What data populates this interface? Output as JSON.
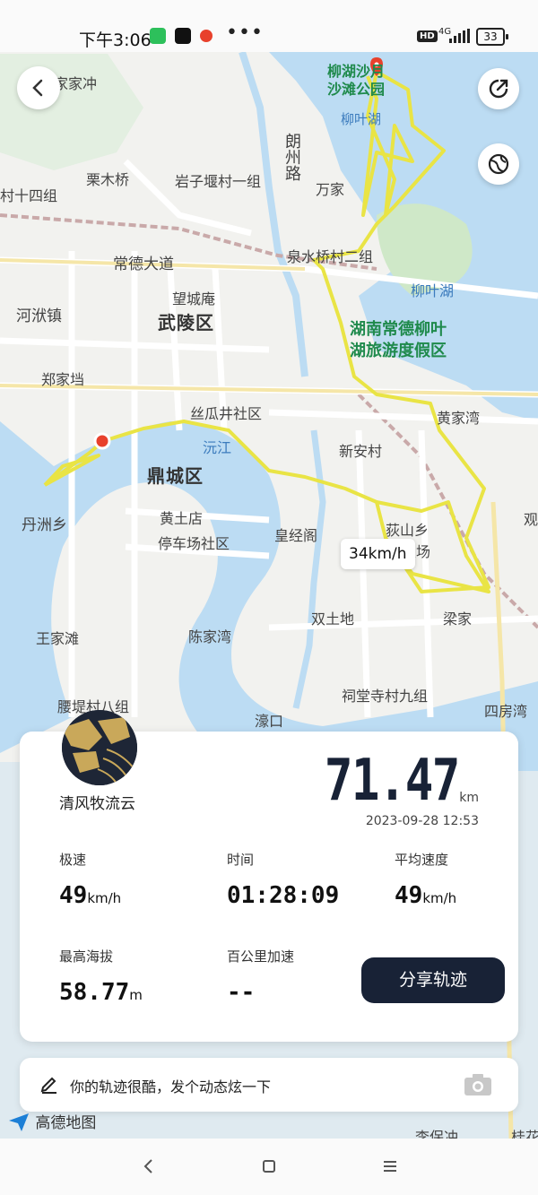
{
  "status_bar": {
    "time": "下午3:06",
    "hd": "HD",
    "network": "4G",
    "battery": "33"
  },
  "map": {
    "labels": {
      "liuhu_park": "柳湖沙月\n沙滩公园",
      "liuye_lake_top": "柳叶湖",
      "langzhou_road": "朗州路",
      "wanjia": "万家",
      "jiajiachong": "家家冲",
      "limuqiao": "栗木桥",
      "yanziyan": "岩子堰村一组",
      "village14": "村十四组",
      "quanshuiqiao": "泉水桥村二组",
      "liuye_lake": "柳叶湖",
      "changde_road": "常德大道",
      "wangchengan": "望城庵",
      "wuling": "武陵区",
      "hezhuang": "河洑镇",
      "resort": "湖南常德柳叶\n湖旅游度假区",
      "zhengjiadang": "郑家垱",
      "siguajing": "丝瓜井社区",
      "huangjiawan": "黄家湾",
      "yuanjiang": "沅江",
      "dingcheng": "鼎城区",
      "xinan": "新安村",
      "danzhou": "丹洲乡",
      "huangtudian": "黄土店",
      "tingchechang": "停车场社区",
      "huangjingge": "皇经阁",
      "disha": "荻山乡",
      "yejiawu": "叶家屋场",
      "shuangtudi": "双土地",
      "liangjia": "梁家",
      "wangjiatan": "王家滩",
      "chenjiawan": "陈家湾",
      "yaodi": "腰堤村八组",
      "citangsi": "祠堂寺村九组",
      "haokou": "濠口",
      "sifangwan": "四房湾",
      "guan": "观",
      "lichong": "李保冲",
      "guijiang": "桂花"
    },
    "speed_tooltip": "34km/h"
  },
  "card": {
    "username": "清风牧流云",
    "distance": "71.47",
    "distance_unit": "km",
    "datetime": "2023-09-28 12:53",
    "stats": {
      "max_speed_label": "极速",
      "max_speed_value": "49",
      "max_speed_unit": "km/h",
      "time_label": "时间",
      "time_value": "01:28:09",
      "avg_speed_label": "平均速度",
      "avg_speed_value": "49",
      "avg_speed_unit": "km/h",
      "max_alt_label": "最高海拔",
      "max_alt_value": "58.77",
      "max_alt_unit": "m",
      "accel_label": "百公里加速",
      "accel_value": "--"
    },
    "share_label": "分享轨迹"
  },
  "comment_bar": {
    "placeholder": "你的轨迹很酷，发个动态炫一下"
  },
  "brand": "高德地图",
  "colors": {
    "track": "#e9e445",
    "water": "#bcdcf3",
    "dark_navy": "#182236",
    "pin": "#e8412c"
  }
}
